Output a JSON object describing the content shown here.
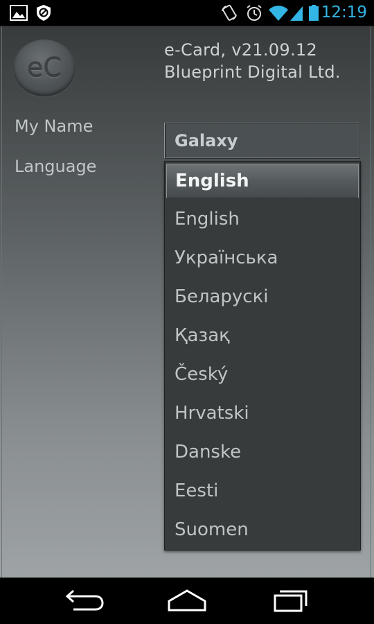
{
  "status_bar": {
    "time": "12:19",
    "icons": [
      "gallery-icon",
      "block-icon",
      "sync-icon",
      "alarm-icon",
      "wifi-icon",
      "signal-icon",
      "battery-icon"
    ]
  },
  "app": {
    "logo_text": "eC",
    "version_line": "e-Card,  v21.09.12",
    "company_line": "Blueprint Digital Ltd.",
    "labels": {
      "my_name": "My Name",
      "language": "Language"
    },
    "name_value": "Galaxy"
  },
  "language_dropdown": {
    "selected": "English",
    "options": [
      "English",
      "Українська",
      "Беларускі",
      "Қазақ",
      "Český",
      "Hrvatski",
      "Danske",
      "Eesti",
      "Suomen"
    ]
  },
  "nav_bar": {
    "buttons": [
      "back-icon",
      "home-icon",
      "recents-icon"
    ]
  },
  "colors": {
    "accent": "#33b5e5",
    "dropdown_bg": "#373b3c",
    "text_light": "#cdd2d4"
  }
}
